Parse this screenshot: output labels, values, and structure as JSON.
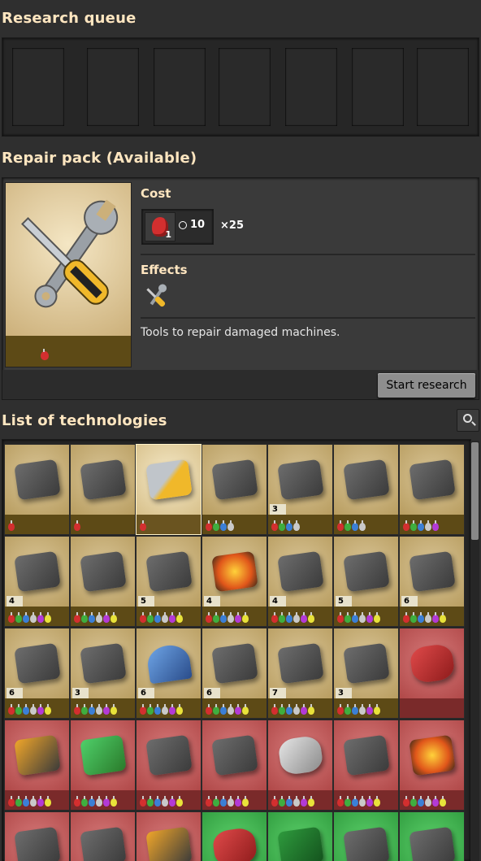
{
  "queue": {
    "title": "Research queue"
  },
  "detail": {
    "title": "Repair pack (Available)",
    "cost_label": "Cost",
    "cost_pack_count": "1",
    "cost_time": "10",
    "cost_multiplier": "25",
    "effects_label": "Effects",
    "description": "Tools to repair damaged machines.",
    "start_button": "Start research"
  },
  "list": {
    "title": "List of technologies",
    "search_icon": "search-icon",
    "tiles": [
      {
        "state": "avail",
        "icon": "crossbow",
        "level": "",
        "packs": 1
      },
      {
        "state": "avail",
        "icon": "inserter",
        "level": "",
        "packs": 1
      },
      {
        "state": "cur",
        "icon": "repair-tools",
        "level": "",
        "packs": 1
      },
      {
        "state": "avail",
        "icon": "machine",
        "level": "",
        "packs": 4
      },
      {
        "state": "avail",
        "icon": "robot",
        "level": "3",
        "packs": 4
      },
      {
        "state": "avail",
        "icon": "robot-worker",
        "level": "",
        "packs": 4
      },
      {
        "state": "avail",
        "icon": "roboport",
        "level": "",
        "packs": 5
      },
      {
        "state": "avail",
        "icon": "rifle",
        "level": "4",
        "packs": 6
      },
      {
        "state": "avail",
        "icon": "suit",
        "level": "",
        "packs": 6
      },
      {
        "state": "avail",
        "icon": "laser",
        "level": "5",
        "packs": 6
      },
      {
        "state": "avail",
        "icon": "fire",
        "level": "4",
        "packs": 6
      },
      {
        "state": "avail",
        "icon": "grenade",
        "level": "4",
        "packs": 6
      },
      {
        "state": "avail",
        "icon": "laser-turret",
        "level": "5",
        "packs": 6
      },
      {
        "state": "avail",
        "icon": "ammo",
        "level": "6",
        "packs": 6
      },
      {
        "state": "avail",
        "icon": "rocket",
        "level": "6",
        "packs": 6
      },
      {
        "state": "avail",
        "icon": "drone",
        "level": "3",
        "packs": 6
      },
      {
        "state": "avail",
        "icon": "dome",
        "level": "6",
        "packs": 6
      },
      {
        "state": "avail",
        "icon": "train",
        "level": "6",
        "packs": 6
      },
      {
        "state": "avail",
        "icon": "arm",
        "level": "7",
        "packs": 6
      },
      {
        "state": "avail",
        "icon": "drill",
        "level": "3",
        "packs": 6
      },
      {
        "state": "locked",
        "icon": "capsule",
        "level": "",
        "packs": 0
      },
      {
        "state": "locked",
        "icon": "armor",
        "level": "",
        "packs": 6
      },
      {
        "state": "locked",
        "icon": "rails",
        "level": "",
        "packs": 6
      },
      {
        "state": "locked",
        "icon": "artillery",
        "level": "",
        "packs": 6
      },
      {
        "state": "locked",
        "icon": "reactor",
        "level": "",
        "packs": 6
      },
      {
        "state": "locked",
        "icon": "flask",
        "level": "",
        "packs": 6
      },
      {
        "state": "locked",
        "icon": "spider",
        "level": "",
        "packs": 6
      },
      {
        "state": "locked",
        "icon": "nuke",
        "level": "",
        "packs": 6
      },
      {
        "state": "locked",
        "icon": "cannon",
        "level": "",
        "packs": 6
      },
      {
        "state": "locked",
        "icon": "cannon2",
        "level": "",
        "packs": 6
      },
      {
        "state": "locked",
        "icon": "soldier",
        "level": "",
        "packs": 6
      },
      {
        "state": "green",
        "icon": "red-flask",
        "level": "",
        "packs": 0
      },
      {
        "state": "green",
        "icon": "circuit",
        "level": "",
        "packs": 0
      },
      {
        "state": "green",
        "icon": "engine",
        "level": "",
        "packs": 0
      },
      {
        "state": "green",
        "icon": "factory",
        "level": "",
        "packs": 0
      }
    ]
  },
  "colors": {
    "header_text": "#ffe6c0",
    "available": "#c9b27e",
    "locked": "#c45d5d",
    "researched": "#3fb24f"
  }
}
